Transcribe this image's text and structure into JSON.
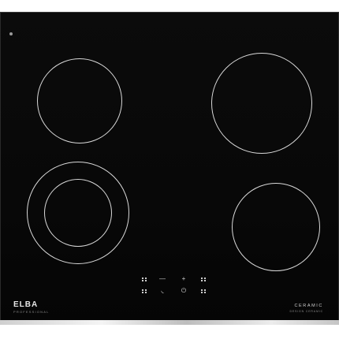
{
  "product": {
    "brand": "ELBA",
    "brand_subtitle": "PROFESSIONAL",
    "series": "CERAMIC",
    "series_subtitle": "DESIGN CERAMIC"
  },
  "colors": {
    "glass": "#0b0b0b",
    "zone_ring": "#d9d9d9",
    "trim": "#e0e0e0"
  },
  "controls": {
    "row1": [
      "keypad-icon",
      "minus-icon",
      "plus-icon",
      "keypad-icon"
    ],
    "row2": [
      "keypad-icon",
      "pan-icon",
      "power-icon",
      "keypad-icon"
    ],
    "minus_symbol": "—",
    "plus_symbol": "+",
    "pan_symbol": "◟",
    "power_symbol": "⏻"
  }
}
